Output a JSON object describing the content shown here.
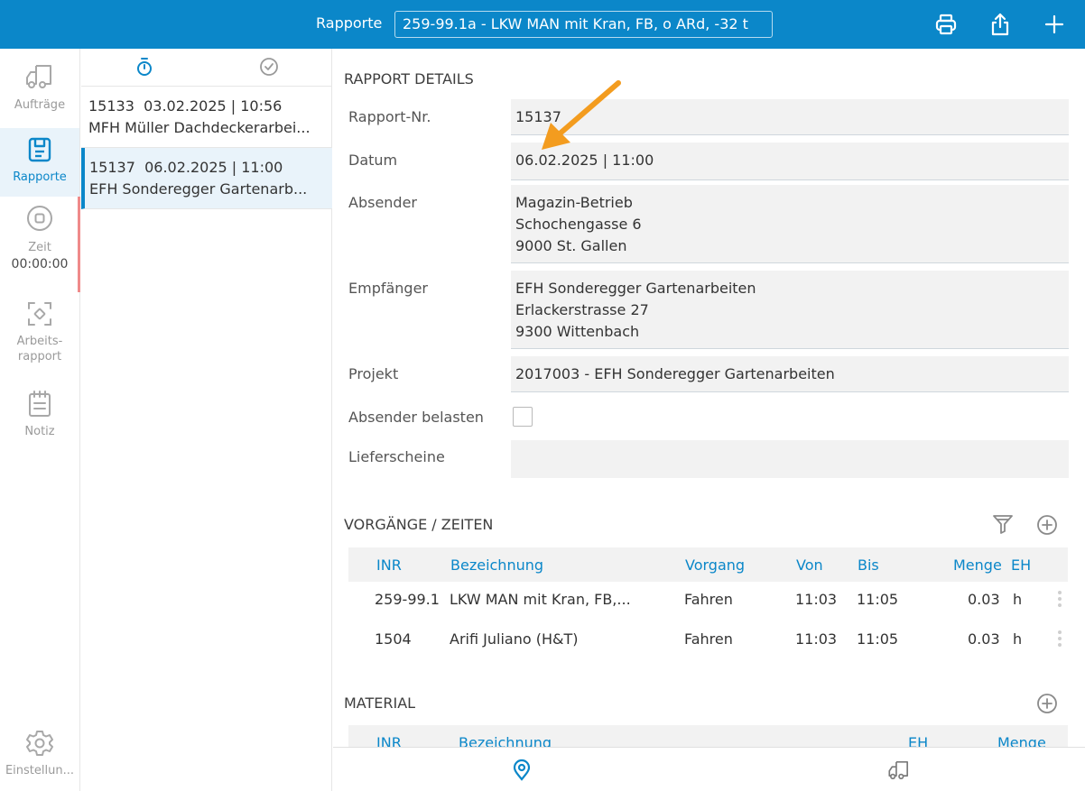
{
  "header": {
    "title": "Rapporte",
    "vehicle_select": "259-99.1a - LKW MAN mit Kran, FB, o ARd, -32 t"
  },
  "nav": {
    "auftraege": "Aufträge",
    "rapporte": "Rapporte",
    "zeit": "Zeit",
    "zeit_value": "00:00:00",
    "arbeitsrapport_1": "Arbeits-",
    "arbeitsrapport_2": "rapport",
    "notiz": "Notiz",
    "einstellungen": "Einstellun..."
  },
  "list": {
    "items": [
      {
        "nr": "15133",
        "date": "03.02.2025 | 10:56",
        "name": "MFH Müller Dachdeckerarbei..."
      },
      {
        "nr": "15137",
        "date": "06.02.2025 | 11:00",
        "name": "EFH Sonderegger Gartenarb..."
      }
    ]
  },
  "details": {
    "section_title": "RAPPORT DETAILS",
    "rapport_nr_label": "Rapport-Nr.",
    "rapport_nr": "15137",
    "datum_label": "Datum",
    "datum": "06.02.2025 | 11:00",
    "absender_label": "Absender",
    "absender": [
      "Magazin-Betrieb",
      "Schochengasse 6",
      "9000 St. Gallen"
    ],
    "empfaenger_label": "Empfänger",
    "empfaenger": [
      "EFH Sonderegger Gartenarbeiten",
      "Erlackerstrasse 27",
      "9300 Wittenbach"
    ],
    "projekt_label": "Projekt",
    "projekt": "2017003 - EFH Sonderegger Gartenarbeiten",
    "absender_belasten_label": "Absender belasten",
    "absender_belasten": false,
    "lieferscheine_label": "Lieferscheine",
    "lieferscheine": ""
  },
  "vorgaenge": {
    "section_title": "VORGÄNGE / ZEITEN",
    "columns": {
      "inr": "INR",
      "bezeichnung": "Bezeichnung",
      "vorgang": "Vorgang",
      "von": "Von",
      "bis": "Bis",
      "menge": "Menge",
      "eh": "EH"
    },
    "rows": [
      {
        "inr": "259-99.1",
        "bezeichnung": "LKW MAN mit Kran, FB,...",
        "vorgang": "Fahren",
        "von": "11:03",
        "bis": "11:05",
        "menge": "0.03",
        "eh": "h"
      },
      {
        "inr": "1504",
        "bezeichnung": "Arifi Juliano (H&T)",
        "vorgang": "Fahren",
        "von": "11:03",
        "bis": "11:05",
        "menge": "0.03",
        "eh": "h"
      }
    ]
  },
  "material": {
    "section_title": "MATERIAL",
    "columns": {
      "inr": "INR",
      "bezeichnung": "Bezeichnung",
      "eh": "EH",
      "menge": "Menge"
    }
  },
  "colors": {
    "accent": "#0b87c9",
    "annotation_arrow": "#f39c1f"
  }
}
